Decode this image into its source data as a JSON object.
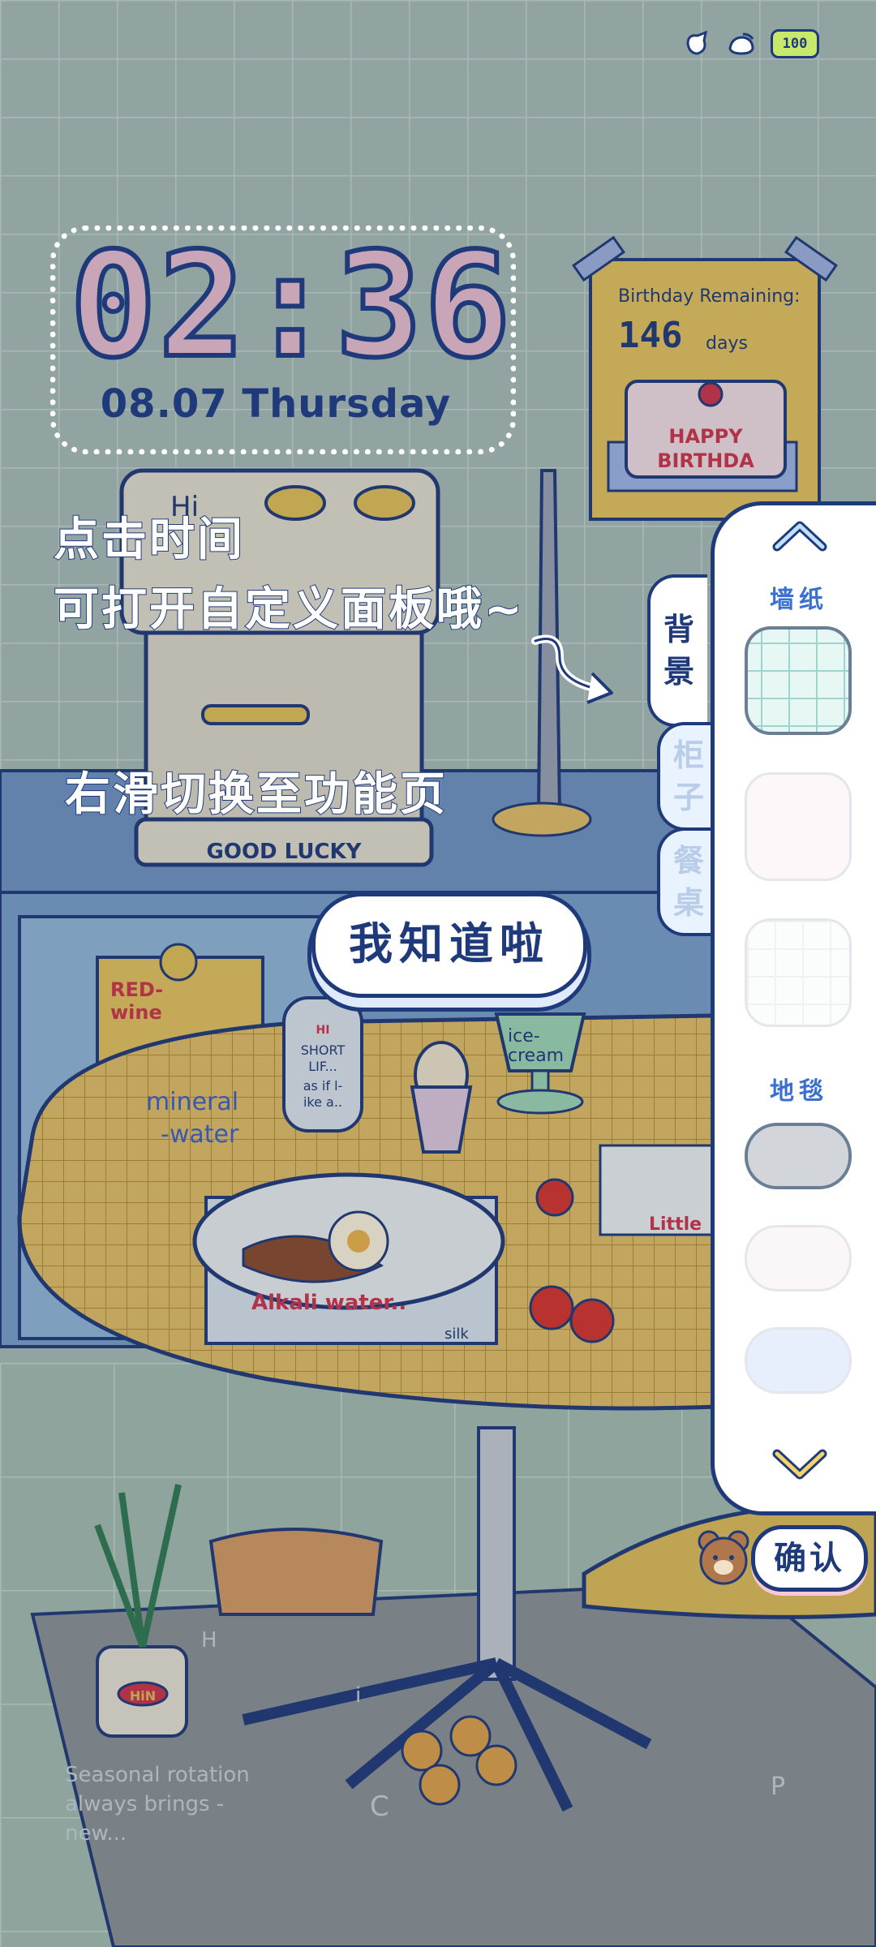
{
  "status_bar": {
    "battery": "100",
    "icons": [
      "notification-icon",
      "wifi-icon",
      "battery-icon"
    ]
  },
  "clock": {
    "time": "02:36",
    "date": "08.07 Thursday"
  },
  "hints": {
    "line1": "点击时间",
    "line2": "可打开自定义面板哦~",
    "swipe": "右滑切换至功能页"
  },
  "ok_button": "我知道啦",
  "panel": {
    "tabs": [
      {
        "label": "背景",
        "active": true
      },
      {
        "label": "柜子",
        "active": false
      },
      {
        "label": "餐桌",
        "active": false
      }
    ],
    "sections": [
      {
        "label": "墙纸",
        "options": [
          "grid-mint",
          "plain-pink",
          "grid-white"
        ],
        "selected": 0
      },
      {
        "label": "地毯",
        "options": [
          "grey",
          "pink",
          "blue"
        ],
        "selected": 0
      }
    ],
    "confirm": "确认"
  },
  "illustration": {
    "birthday_title": "Birthday Remaining:",
    "birthday_days": "146",
    "birthday_unit": "days",
    "cake_line1": "HAPPY",
    "cake_line2": "BIRTHDA",
    "coffee_machine_text": "GOOD LUCKY",
    "coffee_machine_top": "Hi",
    "poster_line1": "RED-",
    "poster_line2": "wine",
    "mineral_line1": "mineral",
    "mineral_line2": "-water",
    "bottle_label": "HI",
    "bottle_line1": "SHORT",
    "bottle_line2": "LIF...",
    "bottle_line3": "as if l-",
    "bottle_line4": "ike a..",
    "icecream_line1": "ice-",
    "icecream_line2": "cream",
    "placemat_text": "Alkali water..",
    "placemat_small": "silk",
    "napkin_text": "Little",
    "pot_label": "HiN",
    "floor_line1": "Seasonal rotation",
    "floor_line2": "always brings -",
    "floor_line3": "new...",
    "floor_letters": [
      "H",
      "i",
      "C",
      "P"
    ]
  },
  "colors": {
    "outline": "#1f3a7a",
    "wall": "#a9bdb9",
    "counter": "#6f94c4",
    "table": "#e1bd58",
    "rug": "#8c9296"
  }
}
